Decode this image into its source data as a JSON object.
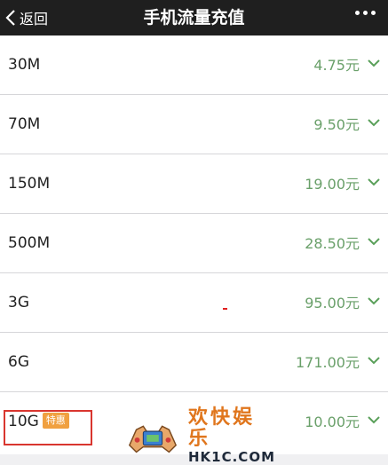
{
  "navbar": {
    "back_label": "返回",
    "title": "手机流量充值",
    "more_icon": "more-dots-icon",
    "back_icon": "chevron-left-icon"
  },
  "plans": [
    {
      "size": "30M",
      "price": "4.75元"
    },
    {
      "size": "70M",
      "price": "9.50元"
    },
    {
      "size": "150M",
      "price": "19.00元"
    },
    {
      "size": "500M",
      "price": "28.50元"
    },
    {
      "size": "3G",
      "price": "95.00元"
    },
    {
      "size": "6G",
      "price": "171.00元"
    },
    {
      "size": "10G",
      "price": "10.00元",
      "badge": "特惠"
    }
  ],
  "watermark": {
    "cn": "欢快娱乐",
    "en": "HK1C.COM"
  },
  "colors": {
    "navbar_bg": "#1f1f1f",
    "price": "#6aa06a",
    "badge_bg": "#f0a040",
    "highlight": "#d9362f",
    "watermark_cn": "#e0761d"
  }
}
